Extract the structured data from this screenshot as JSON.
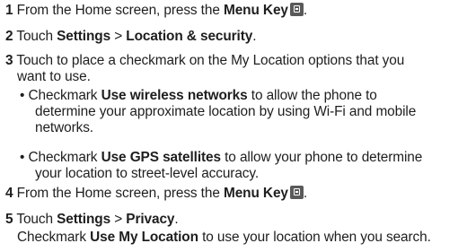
{
  "steps": {
    "s1": {
      "num": "1",
      "pre": " From the Home screen, press the ",
      "bold": "Menu Key",
      "key_icon": "menu-key-icon"
    },
    "s2": {
      "num": "2",
      "pre": " Touch ",
      "bold1": "Settings",
      "sep": " > ",
      "bold2": "Location & security",
      "post": "."
    },
    "s3": {
      "num": "3",
      "line1": " Touch to place a checkmark on the My Location options that you",
      "line2": "want to use."
    },
    "b1": {
      "bullet": "•",
      "pre": " Checkmark ",
      "bold": "Use wireless networks",
      "post": " to allow the phone to",
      "line2": "determine your approximate location by using Wi-Fi and mobile",
      "line3": "networks."
    },
    "b2": {
      "bullet": "•",
      "pre": " Checkmark ",
      "bold": "Use GPS satellites",
      "post": " to allow your phone to determine",
      "line2": "your location to street-level accuracy."
    },
    "s4": {
      "num": "4",
      "pre": " From the Home screen, press the ",
      "bold": "Menu Key",
      "key_icon": "menu-key-icon"
    },
    "s5": {
      "num": "5",
      "pre": " Touch ",
      "bold1": "Settings",
      "sep": " > ",
      "bold2": "Privacy",
      "post": "."
    },
    "s5b": {
      "pre": "Checkmark ",
      "bold": "Use My Location",
      "post": " to use your location when you search."
    }
  }
}
